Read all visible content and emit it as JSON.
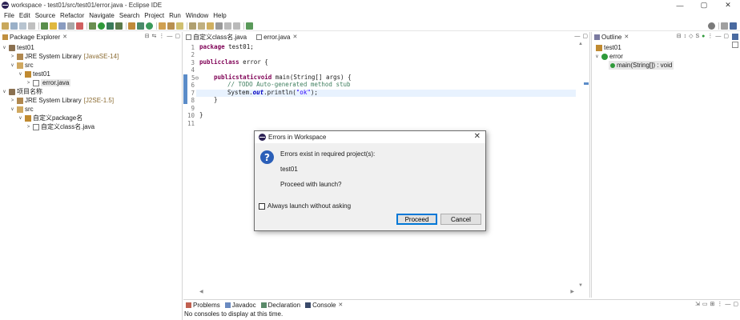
{
  "window": {
    "title": "workspace - test01/src/test01/error.java - Eclipse IDE",
    "controls": [
      "—",
      "▢",
      "✕"
    ]
  },
  "menu": [
    "File",
    "Edit",
    "Source",
    "Refactor",
    "Navigate",
    "Search",
    "Project",
    "Run",
    "Window",
    "Help"
  ],
  "package_explorer": {
    "tab_label": "Package Explorer",
    "tree": [
      {
        "label": "test01",
        "twisty": "∨"
      },
      {
        "label": "JRE System Library",
        "decoration": "[JavaSE-14]",
        "twisty": ">"
      },
      {
        "label": "src",
        "twisty": "∨"
      },
      {
        "label": "test01",
        "twisty": "∨"
      },
      {
        "label": "error.java",
        "twisty": ">"
      },
      {
        "label": "项目名称",
        "twisty": "∨"
      },
      {
        "label": "JRE System Library",
        "decoration": "[J2SE-1.5]",
        "twisty": ">"
      },
      {
        "label": "src",
        "twisty": "∨"
      },
      {
        "label": "自定义package名",
        "twisty": "∨"
      },
      {
        "label": "自定义class名.java",
        "twisty": ">"
      }
    ]
  },
  "editor": {
    "tabs": [
      {
        "label": "自定义class名.java"
      },
      {
        "label": "error.java"
      }
    ],
    "line_numbers": [
      "1",
      "2",
      "3",
      "4",
      "5⊖",
      "6",
      "7",
      "8",
      "9",
      "10",
      "11"
    ],
    "code": {
      "l1_kw": "package",
      "l1_rest": " test01;",
      "l3_kw1": "public",
      "l3_kw2": "class",
      "l3_rest": " error {",
      "l5_kw1": "public",
      "l5_kw2": "static",
      "l5_kw3": "void",
      "l5_rest": " main(String[] args) {",
      "l6_comment": "// TODO Auto-generated method stub",
      "l7_a": "System.",
      "l7_field": "out",
      "l7_b": ".println(",
      "l7_str": "\"ok\"",
      "l7_c": ");",
      "l8": "}",
      "l10": "}"
    }
  },
  "outline": {
    "tab_label": "Outline",
    "tree": [
      {
        "label": "test01"
      },
      {
        "label": "error",
        "twisty": "∨"
      },
      {
        "label": "main(String[]) : void"
      }
    ]
  },
  "console": {
    "tabs": [
      "Problems",
      "Javadoc",
      "Declaration",
      "Console"
    ],
    "message": "No consoles to display at this time."
  },
  "dialog": {
    "title": "Errors in Workspace",
    "line1": "Errors exist in required project(s):",
    "line2": "test01",
    "line3": "Proceed with launch?",
    "checkbox_label": "Always launch without asking",
    "proceed": "Proceed",
    "cancel": "Cancel",
    "question_glyph": "?",
    "close_glyph": "✕"
  },
  "colors": {
    "keyword": "#7f0055",
    "comment": "#3f7f5f",
    "string": "#2a00ff",
    "field": "#0000c0",
    "decoration": "#8a6a30"
  }
}
